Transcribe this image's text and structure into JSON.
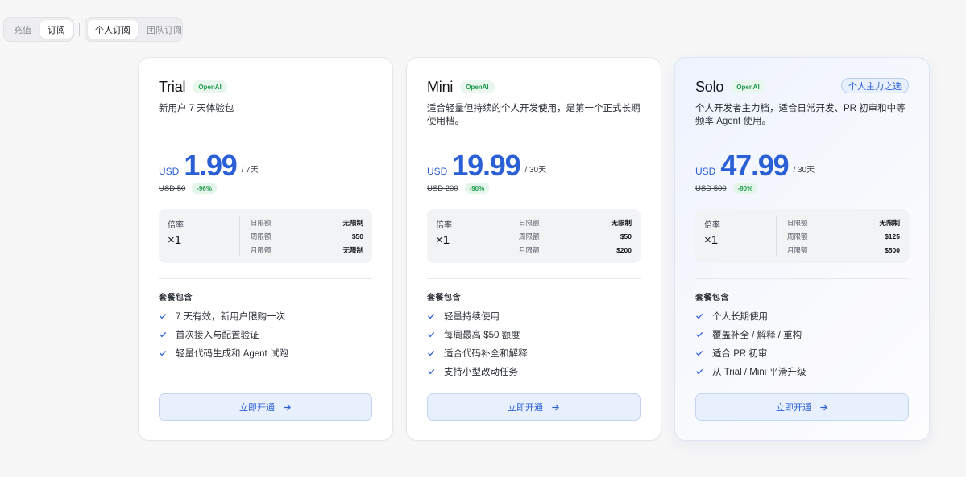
{
  "tabs_primary": {
    "recharge": "充值",
    "subscribe": "订阅",
    "active": "subscribe"
  },
  "tabs_secondary": {
    "personal": "个人订阅",
    "team": "团队订阅",
    "active": "personal"
  },
  "colors": {
    "accent": "#2a5fd6",
    "discount": "#1d9a4c"
  },
  "plans": [
    {
      "name": "Trial",
      "provider": "OpenAI",
      "badge": "",
      "desc": "新用户 7 天体验包",
      "currency": "USD",
      "price": "1.99",
      "period": "/ 7天",
      "original": "USD 50",
      "discount": "-96%",
      "rate_label": "倍率",
      "rate_value": "×1",
      "limits": [
        {
          "k": "日限额",
          "v": "无限制"
        },
        {
          "k": "周限额",
          "v": "$50"
        },
        {
          "k": "月限额",
          "v": "无限制"
        }
      ],
      "includes_title": "套餐包含",
      "features": [
        "7 天有效，新用户限购一次",
        "首次接入与配置验证",
        "轻量代码生成和 Agent 试跑"
      ],
      "cta": "立即开通"
    },
    {
      "name": "Mini",
      "provider": "OpenAI",
      "badge": "",
      "desc": "适合轻量但持续的个人开发使用，是第一个正式长期使用档。",
      "currency": "USD",
      "price": "19.99",
      "period": "/ 30天",
      "original": "USD 200",
      "discount": "-90%",
      "rate_label": "倍率",
      "rate_value": "×1",
      "limits": [
        {
          "k": "日限额",
          "v": "无限制"
        },
        {
          "k": "周限额",
          "v": "$50"
        },
        {
          "k": "月限额",
          "v": "$200"
        }
      ],
      "includes_title": "套餐包含",
      "features": [
        "轻量持续使用",
        "每周最高 $50 额度",
        "适合代码补全和解释",
        "支持小型改动任务"
      ],
      "cta": "立即开通"
    },
    {
      "name": "Solo",
      "provider": "OpenAI",
      "badge": "个人主力之选",
      "desc": "个人开发者主力档，适合日常开发、PR 初审和中等频率 Agent 使用。",
      "currency": "USD",
      "price": "47.99",
      "period": "/ 30天",
      "original": "USD 500",
      "discount": "-90%",
      "rate_label": "倍率",
      "rate_value": "×1",
      "limits": [
        {
          "k": "日限额",
          "v": "无限制"
        },
        {
          "k": "周限额",
          "v": "$125"
        },
        {
          "k": "月限额",
          "v": "$500"
        }
      ],
      "includes_title": "套餐包含",
      "features": [
        "个人长期使用",
        "覆盖补全 / 解释 / 重构",
        "适合 PR 初审",
        "从 Trial / Mini 平滑升级"
      ],
      "cta": "立即开通"
    }
  ]
}
